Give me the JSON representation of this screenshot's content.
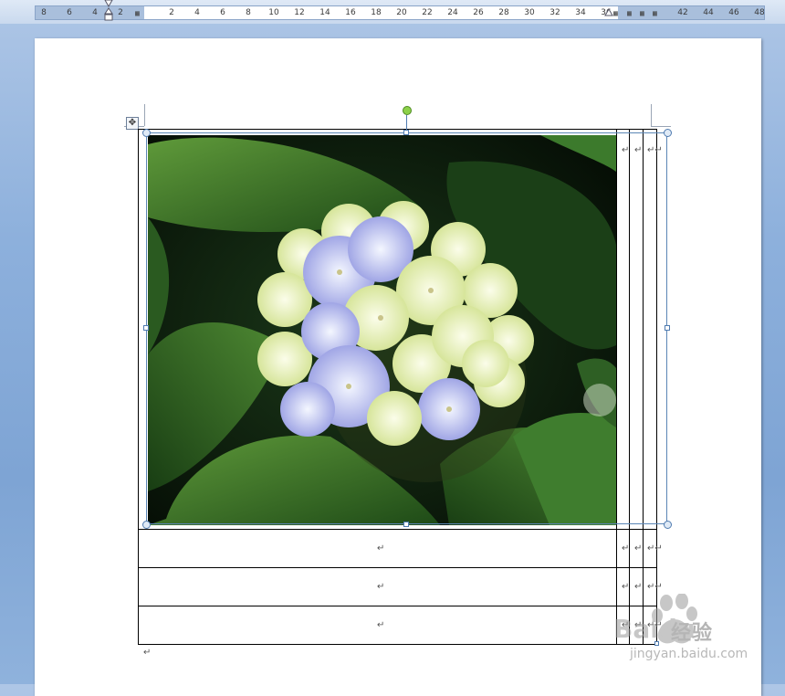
{
  "ruler": {
    "left_ticks": [
      "8",
      "6",
      "4",
      "2"
    ],
    "right_ticks": [
      "2",
      "4",
      "6",
      "8",
      "10",
      "12",
      "14",
      "16",
      "18",
      "20",
      "22",
      "24",
      "26",
      "28",
      "30",
      "32",
      "34",
      "36"
    ],
    "far_ticks": [
      "42",
      "44",
      "46",
      "48"
    ]
  },
  "document": {
    "paragraph_mark": "↵",
    "table_cell_mark": "↵",
    "end_of_row_mark": "↵↵",
    "picture": {
      "description_icon": "hydrangea-photo"
    }
  },
  "watermark": {
    "logo_letters": "Baidu",
    "name": "经验",
    "url": "jingyan.baidu.com"
  },
  "icons": {
    "move_handle": "move-arrows-icon",
    "rotate": "rotate-handle-icon"
  }
}
